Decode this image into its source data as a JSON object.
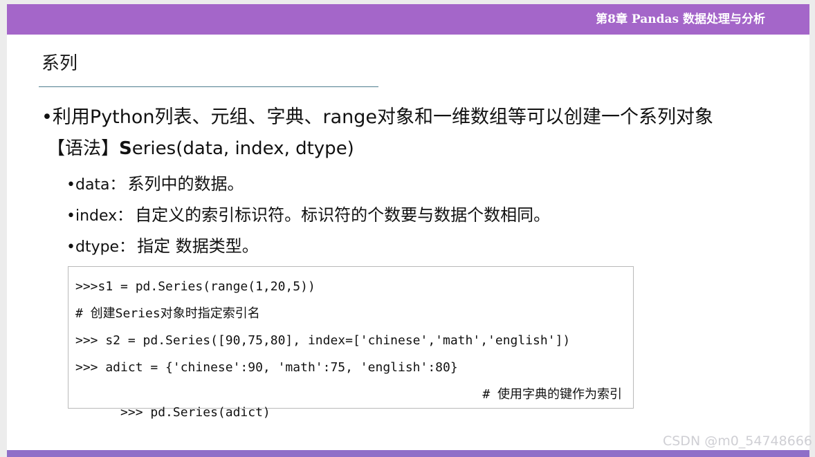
{
  "header": {
    "chapter": "第8章 Pandas 数据处理与分析"
  },
  "slide": {
    "title": "系列",
    "bullet_main": "•利用Python列表、元组、字典、range对象和一维数组等可以创建一个系列对象",
    "syntax": {
      "prefix": "【语法】",
      "strong": "S",
      "rest": "eries(data, index, dtype)"
    },
    "params": [
      {
        "term": "•data：",
        "desc": "系列中的数据。"
      },
      {
        "term": "•index：",
        "desc": "自定义的索引标识符。标识符的个数要与数据个数相同。"
      },
      {
        "term": "•dtype：",
        "desc": "指定 数据类型。"
      }
    ],
    "code_lines": [
      ">>>s1 = pd.Series(range(1,20,5))",
      "# 创建Series对象时指定索引名",
      ">>> s2 = pd.Series([90,75,80], index=['chinese','math','english'])",
      ">>> adict = {'chinese':90, 'math':75, 'english':80}",
      ">>> pd.Series(adict)"
    ],
    "code_note": "# 使用字典的键作为索引"
  },
  "watermark": "CSDN @m0_54748666",
  "colors": {
    "header_band": "#a466c9",
    "footer_band": "#8f6fc8",
    "title_rule": "#4d7c8e"
  }
}
